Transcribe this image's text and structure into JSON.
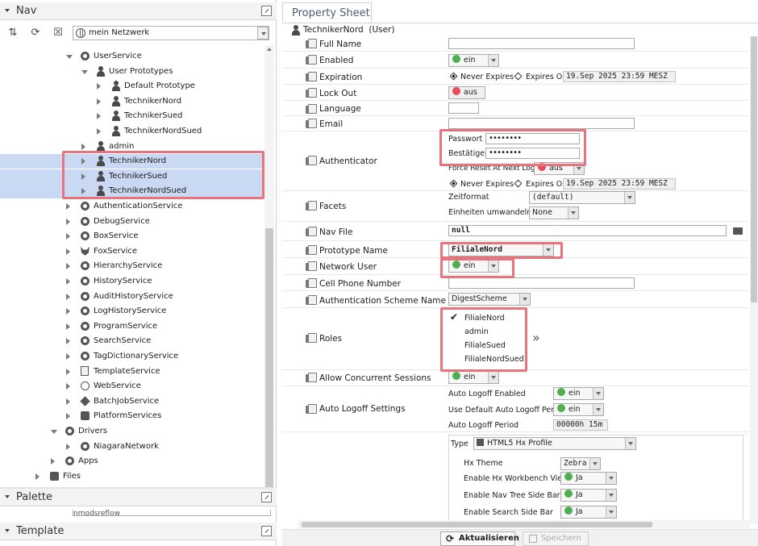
{
  "nav": {
    "title": "Nav",
    "network_select": "mein Netzwerk",
    "tree": [
      {
        "label": "UserService",
        "icon": "svc",
        "indent": 100,
        "arrow": "down"
      },
      {
        "label": "User Prototypes",
        "icon": "user",
        "indent": 119,
        "arrow": "down"
      },
      {
        "label": "Default Prototype",
        "icon": "user",
        "indent": 138,
        "arrow": "right"
      },
      {
        "label": "TechnikerNord",
        "icon": "user",
        "indent": 138,
        "arrow": "right"
      },
      {
        "label": "TechnikerSued",
        "icon": "user",
        "indent": 138,
        "arrow": "right"
      },
      {
        "label": "TechnikerNordSued",
        "icon": "user",
        "indent": 138,
        "arrow": "right"
      },
      {
        "label": "admin",
        "icon": "user",
        "indent": 119,
        "arrow": "right"
      },
      {
        "label": "TechnikerNord",
        "icon": "user",
        "indent": 119,
        "arrow": "right",
        "selected": true
      },
      {
        "label": "TechnikerSued",
        "icon": "user",
        "indent": 119,
        "arrow": "right",
        "selected": true
      },
      {
        "label": "TechnikerNordSued",
        "icon": "user",
        "indent": 119,
        "arrow": "right",
        "selected": true
      },
      {
        "label": "AuthenticationService",
        "icon": "svc",
        "indent": 100,
        "arrow": "right"
      },
      {
        "label": "DebugService",
        "icon": "svc",
        "indent": 100,
        "arrow": "right"
      },
      {
        "label": "BoxService",
        "icon": "svc",
        "indent": 100,
        "arrow": "right"
      },
      {
        "label": "FoxService",
        "icon": "fox",
        "indent": 100,
        "arrow": "right"
      },
      {
        "label": "HierarchyService",
        "icon": "svc",
        "indent": 100,
        "arrow": "right"
      },
      {
        "label": "HistoryService",
        "icon": "svc",
        "indent": 100,
        "arrow": "right"
      },
      {
        "label": "AuditHistoryService",
        "icon": "svc",
        "indent": 100,
        "arrow": "right"
      },
      {
        "label": "LogHistoryService",
        "icon": "svc",
        "indent": 100,
        "arrow": "right"
      },
      {
        "label": "ProgramService",
        "icon": "svc",
        "indent": 100,
        "arrow": "right"
      },
      {
        "label": "SearchService",
        "icon": "svc",
        "indent": 100,
        "arrow": "right"
      },
      {
        "label": "TagDictionaryService",
        "icon": "svc",
        "indent": 100,
        "arrow": "right"
      },
      {
        "label": "TemplateService",
        "icon": "doc",
        "indent": 100,
        "arrow": "right"
      },
      {
        "label": "WebService",
        "icon": "globe",
        "indent": 100,
        "arrow": "right"
      },
      {
        "label": "BatchJobService",
        "icon": "cube",
        "indent": 100,
        "arrow": "right"
      },
      {
        "label": "PlatformServices",
        "icon": "drive",
        "indent": 100,
        "arrow": "right"
      },
      {
        "label": "Drivers",
        "icon": "svc",
        "indent": 81,
        "arrow": "down"
      },
      {
        "label": "NiagaraNetwork",
        "icon": "svc",
        "indent": 100,
        "arrow": "right"
      },
      {
        "label": "Apps",
        "icon": "svc",
        "indent": 81,
        "arrow": "right"
      },
      {
        "label": "Files",
        "icon": "drive",
        "indent": 62,
        "arrow": "right"
      }
    ]
  },
  "palette": {
    "title": "Palette",
    "field": "nmodsreflow"
  },
  "template": {
    "title": "Template"
  },
  "sheet": {
    "tab": "Property Sheet",
    "object_name": "TechnikerNord",
    "object_type": "(User)",
    "full_name": {
      "label": "Full Name",
      "value": ""
    },
    "enabled": {
      "label": "Enabled",
      "value": "ein"
    },
    "expiration": {
      "label": "Expiration",
      "never": "Never Expires",
      "expires_on": "Expires On",
      "date": "19.Sep 2025 23:59 MESZ"
    },
    "lock_out": {
      "label": "Lock Out",
      "value": "aus"
    },
    "language": {
      "label": "Language",
      "value": ""
    },
    "email": {
      "label": "Email",
      "value": ""
    },
    "authenticator": {
      "label": "Authenticator",
      "passwort_label": "Passwort",
      "passwort_value": "••••••••",
      "bestaetigen_label": "Bestätigen",
      "bestaetigen_value": "••••••••",
      "force_reset_label": "Force Reset At Next Login",
      "force_reset_value": "aus",
      "never": "Never Expires",
      "expires_on": "Expires On",
      "date": "19.Sep 2025 23:59 MESZ"
    },
    "facets": {
      "label": "Facets",
      "zeitformat_label": "Zeitformat",
      "zeitformat_value": "(default)",
      "einheiten_label": "Einheiten umwandeln",
      "einheiten_value": "None"
    },
    "nav_file": {
      "label": "Nav File",
      "value": "null"
    },
    "prototype_name": {
      "label": "Prototype Name",
      "value": "FilialeNord"
    },
    "network_user": {
      "label": "Network User",
      "value": "ein"
    },
    "cell_phone": {
      "label": "Cell Phone Number",
      "value": ""
    },
    "auth_scheme": {
      "label": "Authentication Scheme Name",
      "value": "DigestScheme"
    },
    "roles": {
      "label": "Roles",
      "items": [
        "FilialeNord",
        "admin",
        "FilialeSued",
        "FilialeNordSued"
      ],
      "checked": "FilialeNord"
    },
    "concurrent": {
      "label": "Allow Concurrent Sessions",
      "value": "ein"
    },
    "auto_logoff": {
      "label": "Auto Logoff Settings",
      "enabled_label": "Auto Logoff Enabled",
      "enabled_value": "ein",
      "use_default_label": "Use Default Auto Logoff Period",
      "use_default_value": "ein",
      "period_label": "Auto Logoff Period",
      "period_value": "00000h 15m"
    },
    "type": {
      "label": "Type",
      "value": "HTML5 Hx Profile",
      "hx_theme_label": "Hx Theme",
      "hx_theme_value": "Zebra",
      "workbench_label": "Enable Hx Workbench Views",
      "workbench_value": "Ja",
      "nav_tree_label": "Enable Nav Tree Side Bar",
      "nav_tree_value": "Ja",
      "search_label": "Enable Search Side Bar",
      "search_value": "Ja"
    }
  },
  "footer": {
    "refresh": "Aktualisieren",
    "save": "Speichern"
  }
}
